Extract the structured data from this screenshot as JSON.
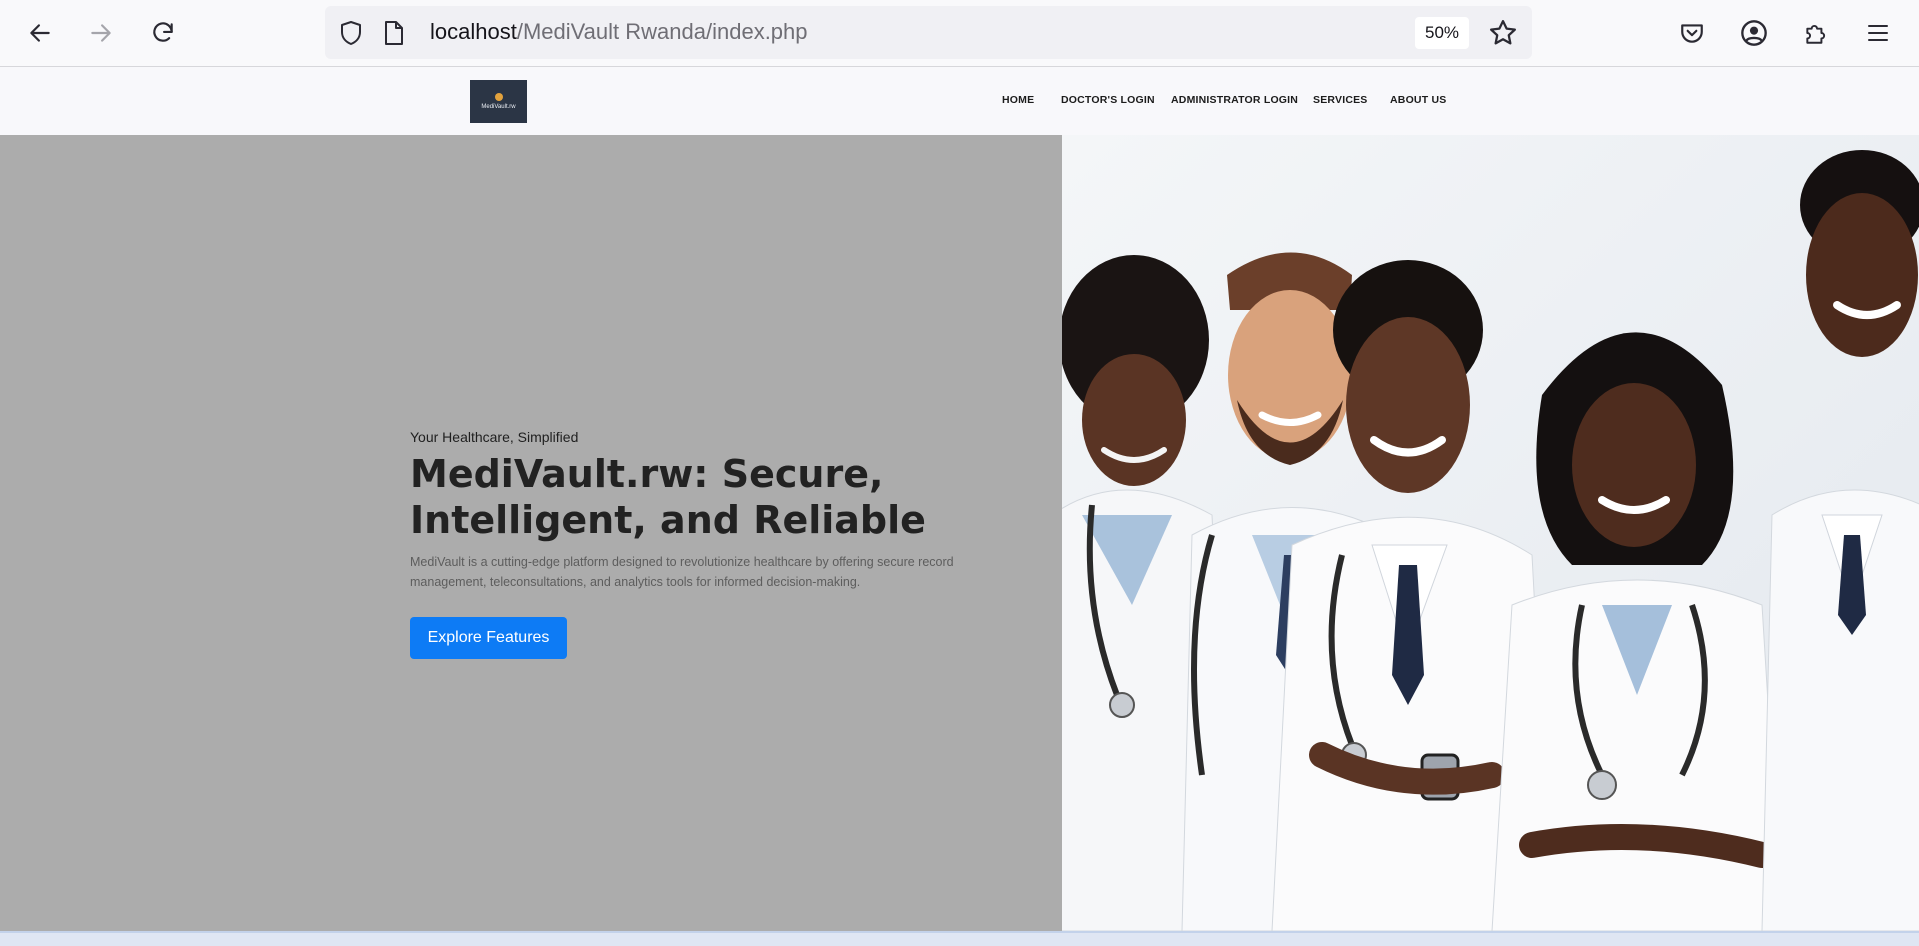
{
  "browser": {
    "url_host": "localhost",
    "url_path": "/MediVault Rwanda/index.php",
    "zoom": "50%"
  },
  "site": {
    "logo_text": "MediVault.rw",
    "nav": [
      {
        "label": "HOME"
      },
      {
        "label": "DOCTOR'S LOGIN"
      },
      {
        "label": "ADMINISTRATOR LOGIN"
      },
      {
        "label": "SERVICES"
      },
      {
        "label": "ABOUT US"
      }
    ]
  },
  "hero": {
    "eyebrow": "Your Healthcare, Simplified",
    "title": "MediVault.rw: Secure, Intelligent, and Reliable",
    "description": "MediVault is a cutting-edge platform designed to revolutionize healthcare by offering secure record management, teleconsultations, and analytics tools for informed decision-making.",
    "cta_label": "Explore Features"
  },
  "colors": {
    "hero_left_bg": "#acacac",
    "cta_bg": "#0d7bf5",
    "header_bg": "#f8f8fb"
  }
}
